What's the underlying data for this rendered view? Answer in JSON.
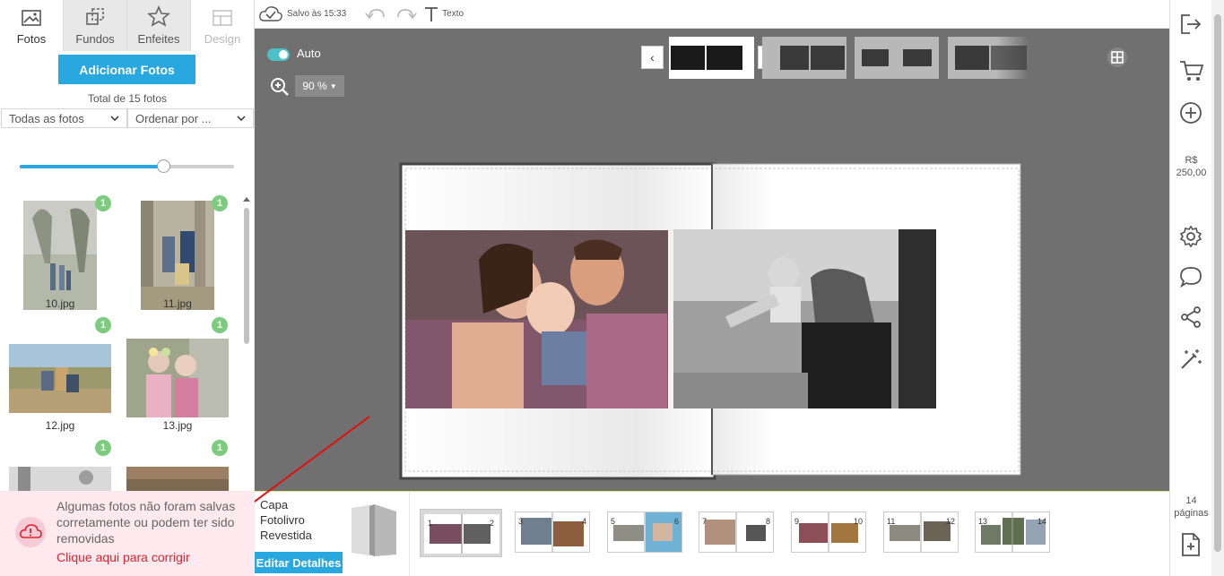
{
  "tabs": [
    {
      "label": "Fotos",
      "icon": "image-icon"
    },
    {
      "label": "Fundos",
      "icon": "crop-icon"
    },
    {
      "label": "Enfeites",
      "icon": "star-icon"
    },
    {
      "label": "Design",
      "icon": "layout-icon"
    }
  ],
  "photos_panel": {
    "add_button": "Adicionar Fotos",
    "total": "Total de 15 fotos",
    "filter_all": "Todas as fotos",
    "sort_by": "Ordenar por ...",
    "size_slider_value": 0.67,
    "items": [
      {
        "name": "10.jpg",
        "count": "1"
      },
      {
        "name": "11.jpg",
        "count": "1"
      },
      {
        "name": "12.jpg",
        "count": "1"
      },
      {
        "name": "13.jpg",
        "count": "1"
      },
      {
        "name": "",
        "count": "1"
      },
      {
        "name": "",
        "count": "1"
      }
    ]
  },
  "toolbar": {
    "saved_text": "Salvo às 15:33",
    "text_label": "Texto"
  },
  "workarea": {
    "auto_label": "Auto",
    "zoom_value": "90 %"
  },
  "right_bar": {
    "price_currency": "R$",
    "price_value": "250,00",
    "pages_count": "14",
    "pages_label": "páginas"
  },
  "bottom": {
    "cover_line1": "Capa",
    "cover_line2": "Fotolivro",
    "cover_line3": "Revestida",
    "edit_details": "Editar Detalhes",
    "spreads": [
      {
        "left": "1",
        "right": "2"
      },
      {
        "left": "3",
        "right": "4"
      },
      {
        "left": "5",
        "right": "6"
      },
      {
        "left": "7",
        "right": "8"
      },
      {
        "left": "9",
        "right": "10"
      },
      {
        "left": "11",
        "right": "12"
      },
      {
        "left": "13",
        "right": "14"
      }
    ]
  },
  "error": {
    "message": "Algumas fotos não foram salvas corretamente ou podem ter sido removidas",
    "link": "Clique aqui para corrigir"
  },
  "colors": {
    "accent": "#29a8e0",
    "badge": "#7ccb7f",
    "error_red": "#e0242f",
    "workarea": "#707070"
  }
}
